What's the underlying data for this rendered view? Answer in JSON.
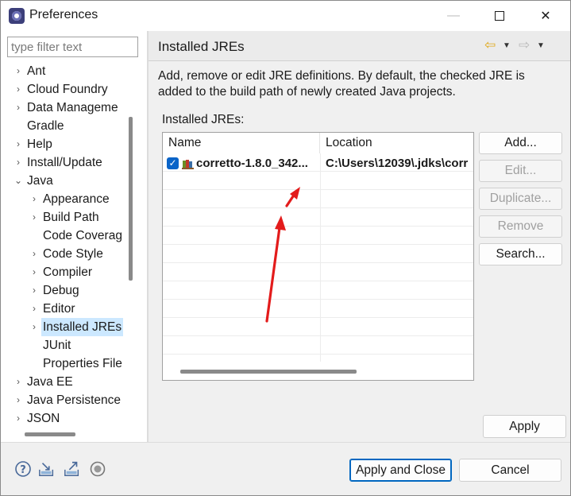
{
  "window": {
    "title": "Preferences",
    "minimize_icon": "—",
    "close_icon": "✕"
  },
  "sidebar": {
    "filter_placeholder": "type filter text",
    "items": [
      {
        "label": "Ant",
        "expander": "›"
      },
      {
        "label": "Cloud Foundry",
        "expander": "›"
      },
      {
        "label": "Data Manageme",
        "expander": "›"
      },
      {
        "label": "Gradle",
        "expander": ""
      },
      {
        "label": "Help",
        "expander": "›"
      },
      {
        "label": "Install/Update",
        "expander": "›"
      },
      {
        "label": "Java",
        "expander": "⌄"
      },
      {
        "label": "Appearance",
        "expander": "›"
      },
      {
        "label": "Build Path",
        "expander": "›"
      },
      {
        "label": "Code Coverag",
        "expander": ""
      },
      {
        "label": "Code Style",
        "expander": "›"
      },
      {
        "label": "Compiler",
        "expander": "›"
      },
      {
        "label": "Debug",
        "expander": "›"
      },
      {
        "label": "Editor",
        "expander": "›"
      },
      {
        "label": "Installed JREs",
        "expander": "›"
      },
      {
        "label": "JUnit",
        "expander": ""
      },
      {
        "label": "Properties File",
        "expander": ""
      },
      {
        "label": "Java EE",
        "expander": "›"
      },
      {
        "label": "Java Persistence",
        "expander": "›"
      },
      {
        "label": "JSON",
        "expander": "›"
      }
    ],
    "selected": "Installed JREs"
  },
  "page": {
    "title": "Installed JREs",
    "nav_back_icon": "⇦",
    "nav_forward_icon": "⇨",
    "dropdown_icon": "▼",
    "description": "Add, remove or edit JRE definitions. By default, the checked JRE is added to the build path of newly created Java projects.",
    "table_label": "Installed JREs:",
    "columns": {
      "name": "Name",
      "location": "Location"
    },
    "rows": [
      {
        "checked": true,
        "check_glyph": "✓",
        "name": "corretto-1.8.0_342...",
        "location": "C:\\Users\\12039\\.jdks\\corr"
      }
    ]
  },
  "buttons": {
    "add": "Add...",
    "edit": "Edit...",
    "duplicate": "Duplicate...",
    "remove": "Remove",
    "search": "Search...",
    "apply": "Apply",
    "apply_close": "Apply and Close",
    "cancel": "Cancel"
  },
  "bottom_icons": [
    "help-icon",
    "import-icon",
    "export-icon",
    "record-icon"
  ],
  "colors": {
    "accent": "#0067c0",
    "selection": "#cce8ff",
    "annotation_arrow": "#e31b1b",
    "checkbox": "#0a64c8"
  }
}
